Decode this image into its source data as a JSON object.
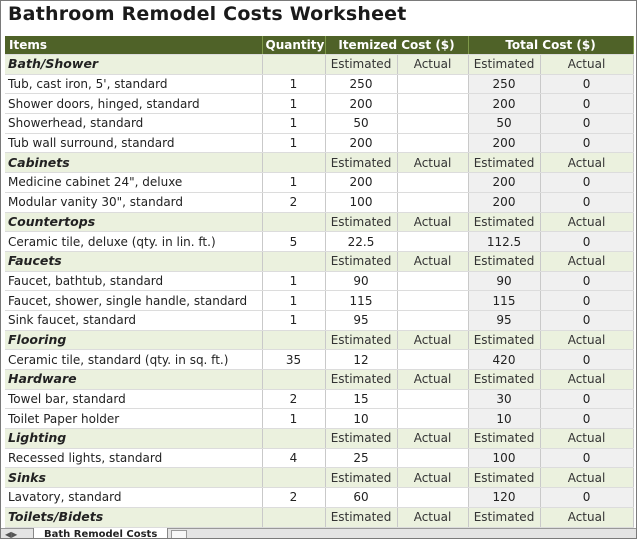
{
  "title": "Bathroom Remodel Costs Worksheet",
  "columns": {
    "items": "Items",
    "quantity": "Quantity",
    "itemized": "Itemized Cost ($)",
    "total": "Total Cost ($)"
  },
  "sub_labels": {
    "estimated": "Estimated",
    "actual": "Actual"
  },
  "categories": [
    {
      "name": "Bath/Shower",
      "items": [
        {
          "name": "Tub, cast iron, 5', standard",
          "qty": "1",
          "est": "250",
          "act": "",
          "tot_est": "250",
          "tot_act": "0"
        },
        {
          "name": "Shower doors, hinged, standard",
          "qty": "1",
          "est": "200",
          "act": "",
          "tot_est": "200",
          "tot_act": "0"
        },
        {
          "name": "Showerhead, standard",
          "qty": "1",
          "est": "50",
          "act": "",
          "tot_est": "50",
          "tot_act": "0"
        },
        {
          "name": "Tub wall surround, standard",
          "qty": "1",
          "est": "200",
          "act": "",
          "tot_est": "200",
          "tot_act": "0"
        }
      ]
    },
    {
      "name": "Cabinets",
      "items": [
        {
          "name": "Medicine cabinet 24\", deluxe",
          "qty": "1",
          "est": "200",
          "act": "",
          "tot_est": "200",
          "tot_act": "0"
        },
        {
          "name": "Modular vanity 30\", standard",
          "qty": "2",
          "est": "100",
          "act": "",
          "tot_est": "200",
          "tot_act": "0"
        }
      ]
    },
    {
      "name": "Countertops",
      "items": [
        {
          "name": "Ceramic tile, deluxe (qty. in lin. ft.)",
          "qty": "5",
          "est": "22.5",
          "act": "",
          "tot_est": "112.5",
          "tot_act": "0"
        }
      ]
    },
    {
      "name": "Faucets",
      "items": [
        {
          "name": "Faucet, bathtub, standard",
          "qty": "1",
          "est": "90",
          "act": "",
          "tot_est": "90",
          "tot_act": "0"
        },
        {
          "name": "Faucet, shower, single handle, standard",
          "qty": "1",
          "est": "115",
          "act": "",
          "tot_est": "115",
          "tot_act": "0"
        },
        {
          "name": "Sink faucet, standard",
          "qty": "1",
          "est": "95",
          "act": "",
          "tot_est": "95",
          "tot_act": "0"
        }
      ]
    },
    {
      "name": "Flooring",
      "items": [
        {
          "name": "Ceramic tile, standard (qty. in sq. ft.)",
          "qty": "35",
          "est": "12",
          "act": "",
          "tot_est": "420",
          "tot_act": "0"
        }
      ]
    },
    {
      "name": "Hardware",
      "items": [
        {
          "name": "Towel bar, standard",
          "qty": "2",
          "est": "15",
          "act": "",
          "tot_est": "30",
          "tot_act": "0"
        },
        {
          "name": "Toilet Paper holder",
          "qty": "1",
          "est": "10",
          "act": "",
          "tot_est": "10",
          "tot_act": "0"
        }
      ]
    },
    {
      "name": "Lighting",
      "items": [
        {
          "name": "Recessed lights, standard",
          "qty": "4",
          "est": "25",
          "act": "",
          "tot_est": "100",
          "tot_act": "0"
        }
      ]
    },
    {
      "name": "Sinks",
      "items": [
        {
          "name": "Lavatory, standard",
          "qty": "2",
          "est": "60",
          "act": "",
          "tot_est": "120",
          "tot_act": "0"
        }
      ]
    },
    {
      "name": "Toilets/Bidets",
      "items": []
    }
  ],
  "sheet_tab": "Bath Remodel Costs",
  "colors": {
    "header_bg": "#4f6228",
    "category_bg": "#ebf1de",
    "total_bg": "#f0f0f0"
  }
}
